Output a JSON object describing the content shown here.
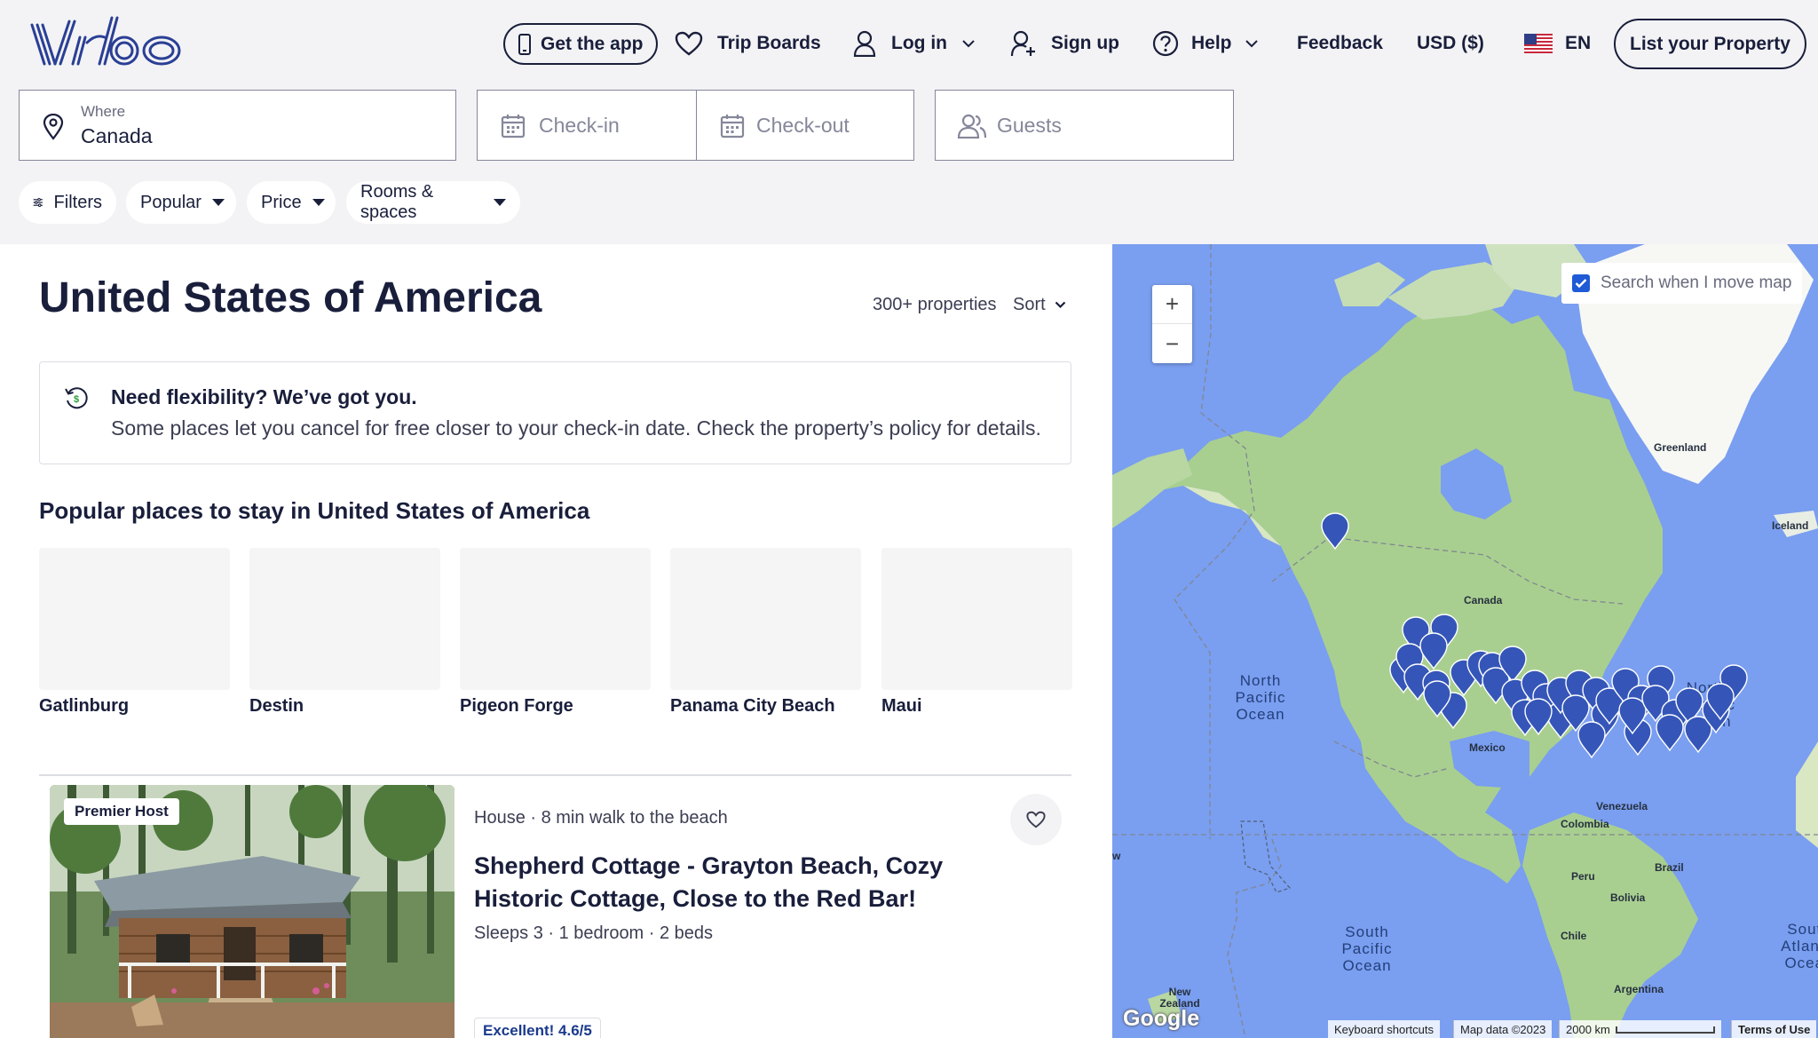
{
  "header": {
    "brand": "Vrbo",
    "get_app": "Get the app",
    "trip_boards": "Trip Boards",
    "login": "Log in",
    "signup": "Sign up",
    "help": "Help",
    "feedback": "Feedback",
    "currency": "USD ($)",
    "language": "EN",
    "list_property": "List your Property"
  },
  "search": {
    "where_label": "Where",
    "where_value": "Canada",
    "checkin_placeholder": "Check-in",
    "checkout_placeholder": "Check-out",
    "guests_placeholder": "Guests"
  },
  "filters": {
    "filters": "Filters",
    "popular": "Popular",
    "price": "Price",
    "rooms": "Rooms & spaces"
  },
  "results": {
    "title": "United States of America",
    "count": "300+ properties",
    "sort": "Sort",
    "flex_title": "Need flexibility? We’ve got you.",
    "flex_text": "Some places let you cancel for free closer to your check-in date. Check the property’s policy for details.",
    "popular_title": "Popular places to stay in United States of America",
    "places": [
      "Gatlinburg",
      "Destin",
      "Pigeon Forge",
      "Panama City Beach",
      "Maui"
    ]
  },
  "listing": {
    "badge": "Premier Host",
    "type": "House · 8 min walk to the beach",
    "title": "Shepherd Cottage - Grayton Beach, Cozy Historic Cottage, Close to the Red Bar!",
    "specs": "Sleeps 3 · 1 bedroom · 2 beds",
    "rating": "Excellent! 4.6/5",
    "saved": false
  },
  "map": {
    "search_when_move": "Search when I move map",
    "search_when_move_checked": true,
    "zoom_in": "+",
    "zoom_out": "−",
    "labels": {
      "greenland": "Greenland",
      "iceland": "Iceland",
      "canada": "Canada",
      "mexico": "Mexico",
      "venezuela": "Venezuela",
      "colombia": "Colombia",
      "peru": "Peru",
      "brazil": "Brazil",
      "bolivia": "Bolivia",
      "chile": "Chile",
      "argentina": "Argentina",
      "new_zealand": "New Zealand",
      "north_pacific": "North Pacific Ocean",
      "north_atlantic": "North Atlantic Ocean",
      "south_pacific": "South Pacific Ocean",
      "south_atlantic": "South Atlantic Ocean",
      "edge_w": "w"
    },
    "google": "Google",
    "keyboard_shortcuts": "Keyboard shortcuts",
    "map_data": "Map data ©2023",
    "scale": "2000 km",
    "terms": "Terms of Use",
    "marker_color": "#3556b8"
  },
  "colors": {
    "brand_navy": "#191e3b",
    "link_blue": "#1f5bd6",
    "land_green": "#a9cf90",
    "ocean_blue": "#7a9ef0"
  }
}
